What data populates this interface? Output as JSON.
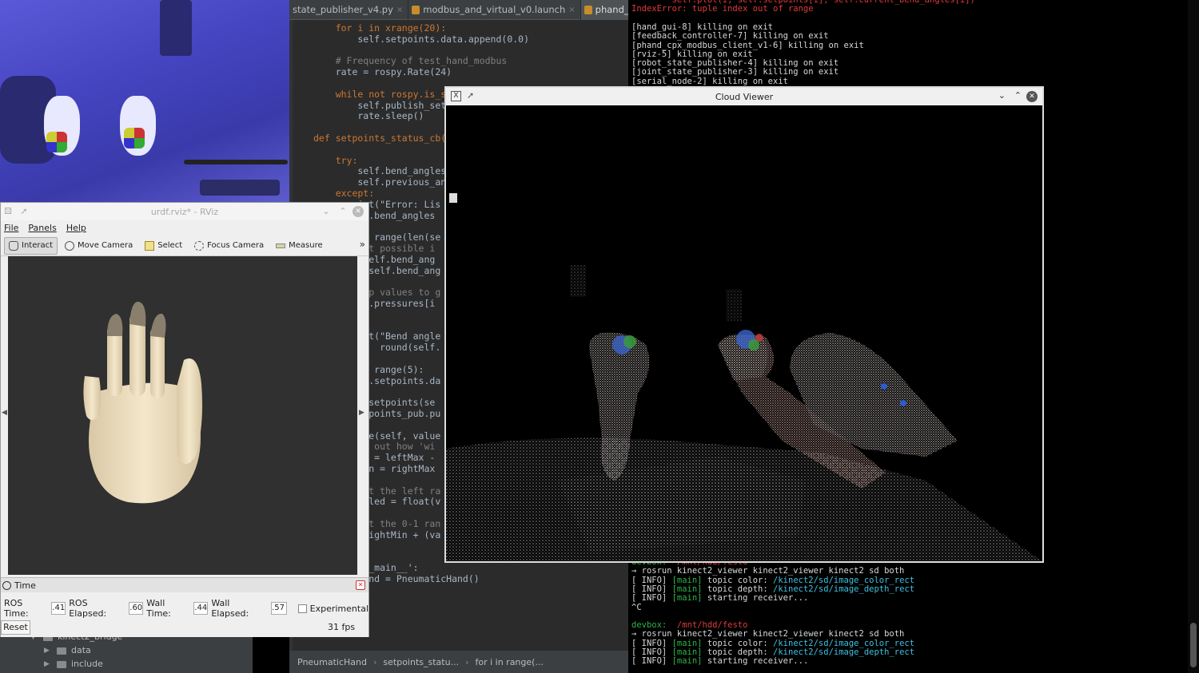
{
  "ide": {
    "tabs": [
      {
        "label": "state_publisher_v4.py",
        "active": false
      },
      {
        "label": "modbus_and_virtual_v0.launch",
        "active": false
      },
      {
        "label": "phand_feedforwa",
        "active": true
      }
    ],
    "code_lines": [
      "    for i in xrange(20):",
      "        self.setpoints.data.append(0.0)",
      "",
      "    # Frequency of test_hand_modbus",
      "    rate = rospy.Rate(24)",
      "",
      "    while not rospy.is_sh",
      "        self.publish_set",
      "        rate.sleep()",
      "",
      "def setpoints_status_cb(",
      "",
      "    try:",
      "        self.bend_angles",
      "        self.previous_ang",
      "    except:",
      "        int(\"Error: Lis",
      "        lf.bend_angles",
      "",
      "        in range(len(se",
      "        Not possible i",
      "         self.bend_ang",
      "          self.bend_ang",
      "",
      "        Map values to g",
      "        lf.pressures[i",
      "",
      "",
      "        int(\"Bend angle",
      "            round(self.",
      "",
      "        in range(5):",
      "        lf.setpoints.da",
      "",
      "        h_setpoints(se",
      "        etpoints_pub.pu",
      "",
      "        ate(self, value",
      "        re out how 'wi",
      "        an = leftMax -",
      "        pan = rightMax",
      "",
      "        ert the left ra",
      "        caled = float(v",
      "",
      "        ert the 0-1 ran",
      "         rightMin + (va",
      "",
      "",
      "        '__main__':",
      "        hand = PneumaticHand()"
    ],
    "breadcrumb": [
      "PneumaticHand",
      "setpoints_statu...",
      "for i in range(..."
    ],
    "tree": [
      {
        "label": "kinect2_bridge",
        "expanded": true
      },
      {
        "label": "data",
        "expanded": false
      },
      {
        "label": "include",
        "expanded": false
      }
    ]
  },
  "terminal": {
    "top_lines": [
      {
        "text": "        self.plot(i, self.setpoints[i], self.current_bend_angles[i])",
        "color": "red"
      },
      {
        "text": "IndexError: tuple index out of range",
        "color": "red"
      },
      {
        "text": "",
        "color": ""
      },
      {
        "text": "[hand_gui-8] killing on exit",
        "color": ""
      },
      {
        "text": "[feedback_controller-7] killing on exit",
        "color": ""
      },
      {
        "text": "[phand_cpx_modbus_client_v1-6] killing on exit",
        "color": ""
      },
      {
        "text": "[rviz-5] killing on exit",
        "color": ""
      },
      {
        "text": "[robot_state_publisher-4] killing on exit",
        "color": ""
      },
      {
        "text": "[joint_state_publisher-3] killing on exit",
        "color": ""
      },
      {
        "text": "[serial_node-2] killing on exit",
        "color": ""
      }
    ],
    "bottom_block_1": {
      "prompt_host": "devbox:",
      "prompt_path": "/mnt/hdd/festo",
      "command": "→ rosrun kinect2_viewer kinect2_viewer kinect2 sd both",
      "info": [
        {
          "prefix": "[ INFO] ",
          "tag": "[main]",
          "text": " topic color: ",
          "value": "/kinect2/sd/image_color_rect"
        },
        {
          "prefix": "[ INFO] ",
          "tag": "[main]",
          "text": " topic depth: ",
          "value": "/kinect2/sd/image_depth_rect"
        },
        {
          "prefix": "[ INFO] ",
          "tag": "[main]",
          "text": " starting receiver...",
          "value": ""
        }
      ],
      "interrupt": "^C"
    },
    "bottom_block_2": {
      "prompt_host": "devbox:",
      "prompt_path": "/mnt/hdd/festo",
      "command": "→ rosrun kinect2_viewer kinect2_viewer kinect2 sd both",
      "info": [
        {
          "prefix": "[ INFO] ",
          "tag": "[main]",
          "text": " topic color: ",
          "value": "/kinect2/sd/image_color_rect"
        },
        {
          "prefix": "[ INFO] ",
          "tag": "[main]",
          "text": " topic depth: ",
          "value": "/kinect2/sd/image_depth_rect"
        },
        {
          "prefix": "[ INFO] ",
          "tag": "[main]",
          "text": " starting receiver...",
          "value": ""
        }
      ]
    }
  },
  "rviz": {
    "title": "urdf.rviz* - RViz",
    "menu": [
      "File",
      "Panels",
      "Help"
    ],
    "tools": [
      {
        "label": "Interact",
        "icon": "hand-pointer-icon",
        "active": true
      },
      {
        "label": "Move Camera",
        "icon": "move-camera-icon",
        "active": false
      },
      {
        "label": "Select",
        "icon": "select-box-icon",
        "active": false
      },
      {
        "label": "Focus Camera",
        "icon": "focus-camera-icon",
        "active": false
      },
      {
        "label": "Measure",
        "icon": "ruler-icon",
        "active": false
      }
    ],
    "more": "»",
    "time": {
      "title": "Time",
      "ros_time_label": "ROS Time:",
      "ros_time": ".41",
      "ros_elapsed_label": "ROS Elapsed:",
      "ros_elapsed": ".60",
      "wall_time_label": "Wall Time:",
      "wall_time": ".44",
      "wall_elapsed_label": "Wall Elapsed:",
      "wall_elapsed": ".57",
      "experimental_label": "Experimental",
      "reset_label": "Reset",
      "fps": "31 fps"
    },
    "colors": {
      "hand": "#f1e4c6",
      "fingertip": "#8a7f6c",
      "viewport": "#303030"
    }
  },
  "cloud_viewer": {
    "title": "Cloud Viewer",
    "app_icon": "X"
  }
}
